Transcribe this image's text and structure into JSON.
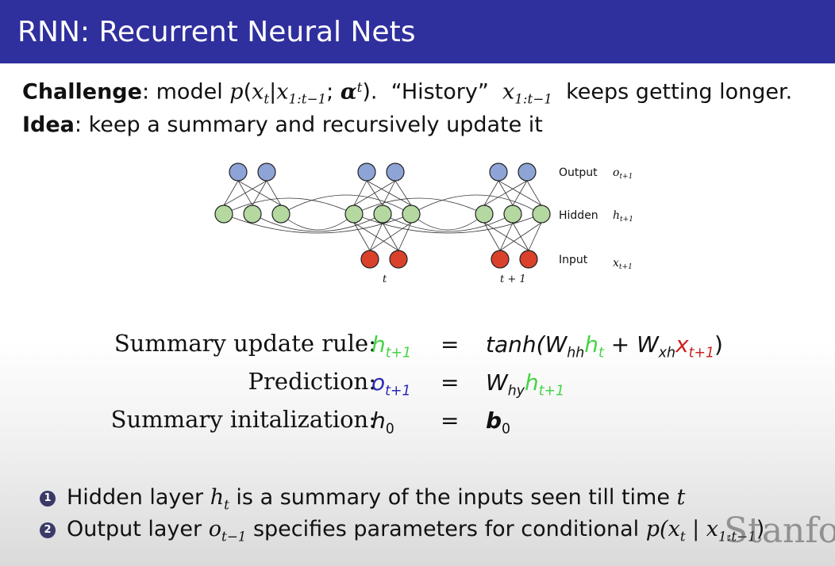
{
  "title": "RNN: Recurrent Neural Nets",
  "challenge": {
    "label": "Challenge",
    "text1": ": model ",
    "p": "p",
    "x": "x",
    "t": "t",
    "bar": "|",
    "range": "1:t−1",
    "semi": ";",
    "alpha": "α",
    "close": ").",
    "text2": "“History”",
    "text3": "keeps getting longer."
  },
  "idea": {
    "label": "Idea",
    "text": ": keep a summary and recursively update it"
  },
  "diagram": {
    "output_label": "Output",
    "output_var": "o",
    "hidden_label": "Hidden",
    "hidden_var": "h",
    "input_label": "Input",
    "input_var": "x",
    "var_sub": "t+1",
    "time_t": "t",
    "time_t1": "t + 1",
    "colors": {
      "output": "#8fa4d6",
      "hidden": "#b4d8a0",
      "input": "#d9412b"
    }
  },
  "equations": {
    "update_label": "Summary update rule:",
    "prediction_label": "Prediction:",
    "init_label": "Summary initalization:",
    "equals": "=",
    "h": "h",
    "o": "o",
    "x": "x",
    "W": "W",
    "b": "b",
    "t1": "t+1",
    "t": "t",
    "zero": "0",
    "hh": "hh",
    "xh": "xh",
    "hy": "hy",
    "tanh": "tanh(",
    "plus": " + ",
    "rparen": ")"
  },
  "bullets": [
    {
      "num": "1",
      "pre": "Hidden layer ",
      "var": "h",
      "sub": "t",
      "post": " is a summary of the inputs seen till time ",
      "tail": "t"
    },
    {
      "num": "2",
      "pre": "Output layer ",
      "var": "o",
      "sub": "t−1",
      "post": " specifies parameters for conditional ",
      "tail": "p(x",
      "tail_sub": "t",
      "tail2": " | x",
      "tail2_sub": "1:t−1",
      "tail3": ")"
    }
  ],
  "watermark": "Stanfo"
}
